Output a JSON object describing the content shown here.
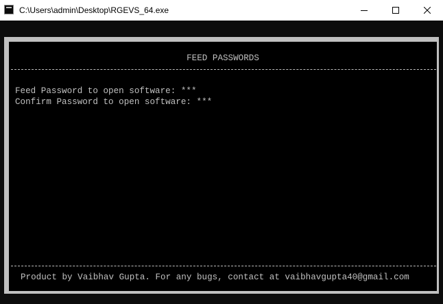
{
  "window": {
    "title": "C:\\Users\\admin\\Desktop\\RGEVS_64.exe",
    "icons": {
      "app": "console-app-icon",
      "minimize": "minimize-icon",
      "maximize": "maximize-icon",
      "close": "close-icon"
    }
  },
  "console": {
    "heading": "FEED PASSWORDS",
    "lines": [
      "Feed Password to open software: ***",
      "Confirm Password to open software: ***"
    ],
    "footer": "Product by Vaibhav Gupta. For any bugs, contact at vaibhavgupta40@gmail.com"
  },
  "colors": {
    "console_bg": "#000000",
    "console_text": "#c0c0c0",
    "frame": "#c0c0c0",
    "titlebar": "#ffffff"
  }
}
